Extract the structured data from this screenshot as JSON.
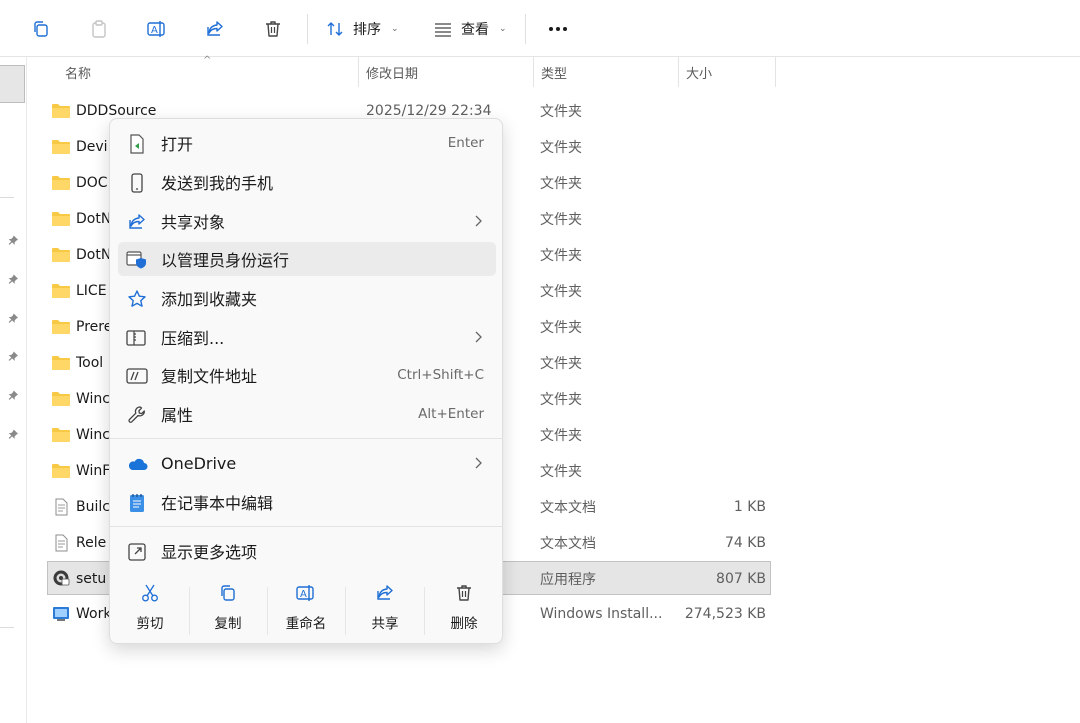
{
  "toolbar": {
    "sort_label": "排序",
    "view_label": "查看"
  },
  "columns": {
    "name": "名称",
    "date": "修改日期",
    "type": "类型",
    "size": "大小"
  },
  "files": [
    {
      "name": "DDDSource",
      "date": "2025/12/29 22:34",
      "type": "文件夹",
      "size": "",
      "icon": "folder-icon"
    },
    {
      "name": "Devi",
      "date": "",
      "type": "文件夹",
      "size": "",
      "icon": "folder-icon"
    },
    {
      "name": "DOC",
      "date": "",
      "type": "文件夹",
      "size": "",
      "icon": "folder-icon"
    },
    {
      "name": "DotN",
      "date": "",
      "type": "文件夹",
      "size": "",
      "icon": "folder-icon"
    },
    {
      "name": "DotN",
      "date": "",
      "type": "文件夹",
      "size": "",
      "icon": "folder-icon"
    },
    {
      "name": "LICE",
      "date": "",
      "type": "文件夹",
      "size": "",
      "icon": "folder-icon"
    },
    {
      "name": "Prere",
      "date": "",
      "type": "文件夹",
      "size": "",
      "icon": "folder-icon"
    },
    {
      "name": "Tool",
      "date": "",
      "type": "文件夹",
      "size": "",
      "icon": "folder-icon"
    },
    {
      "name": "Winc",
      "date": "",
      "type": "文件夹",
      "size": "",
      "icon": "folder-icon"
    },
    {
      "name": "Winc",
      "date": "",
      "type": "文件夹",
      "size": "",
      "icon": "folder-icon"
    },
    {
      "name": "WinF",
      "date": "",
      "type": "文件夹",
      "size": "",
      "icon": "folder-icon"
    },
    {
      "name": "Builc",
      "date": "",
      "type": "文本文档",
      "size": "1 KB",
      "icon": "text-file-icon"
    },
    {
      "name": "Rele",
      "date": "",
      "type": "文本文档",
      "size": "74 KB",
      "icon": "text-file-icon"
    },
    {
      "name": "setu",
      "date": "",
      "type": "应用程序",
      "size": "807 KB",
      "icon": "setup-app-icon",
      "selected": true
    },
    {
      "name": "Work",
      "date": "",
      "type": "Windows Install...",
      "size": "274,523 KB",
      "icon": "installer-icon"
    }
  ],
  "context_menu": {
    "items": [
      {
        "label": "打开",
        "shortcut": "Enter",
        "icon": "open-icon",
        "submenu": false
      },
      {
        "label": "发送到我的手机",
        "shortcut": "",
        "icon": "phone-icon",
        "submenu": false
      },
      {
        "label": "共享对象",
        "shortcut": "",
        "icon": "share-icon",
        "submenu": true
      },
      {
        "label": "以管理员身份运行",
        "shortcut": "",
        "icon": "admin-shield-icon",
        "submenu": false,
        "hover": true
      },
      {
        "label": "添加到收藏夹",
        "shortcut": "",
        "icon": "star-icon",
        "submenu": false
      },
      {
        "label": "压缩到...",
        "shortcut": "",
        "icon": "compress-icon",
        "submenu": true
      },
      {
        "label": "复制文件地址",
        "shortcut": "Ctrl+Shift+C",
        "icon": "copy-path-icon",
        "submenu": false
      },
      {
        "label": "属性",
        "shortcut": "Alt+Enter",
        "icon": "properties-wrench-icon",
        "submenu": false
      },
      {
        "label": "OneDrive",
        "shortcut": "",
        "icon": "onedrive-cloud-icon",
        "submenu": true
      },
      {
        "label": "在记事本中编辑",
        "shortcut": "",
        "icon": "notepad-icon",
        "submenu": false
      },
      {
        "label": "显示更多选项",
        "shortcut": "",
        "icon": "more-options-icon",
        "submenu": false
      }
    ],
    "quick_actions": [
      {
        "label": "剪切",
        "icon": "cut-icon"
      },
      {
        "label": "复制",
        "icon": "copy-icon"
      },
      {
        "label": "重命名",
        "icon": "rename-icon"
      },
      {
        "label": "共享",
        "icon": "share-icon"
      },
      {
        "label": "删除",
        "icon": "delete-icon"
      }
    ]
  },
  "colors": {
    "accent": "#0f6cbd",
    "folder": "#f8c944",
    "selection": "#e5e5e5"
  }
}
